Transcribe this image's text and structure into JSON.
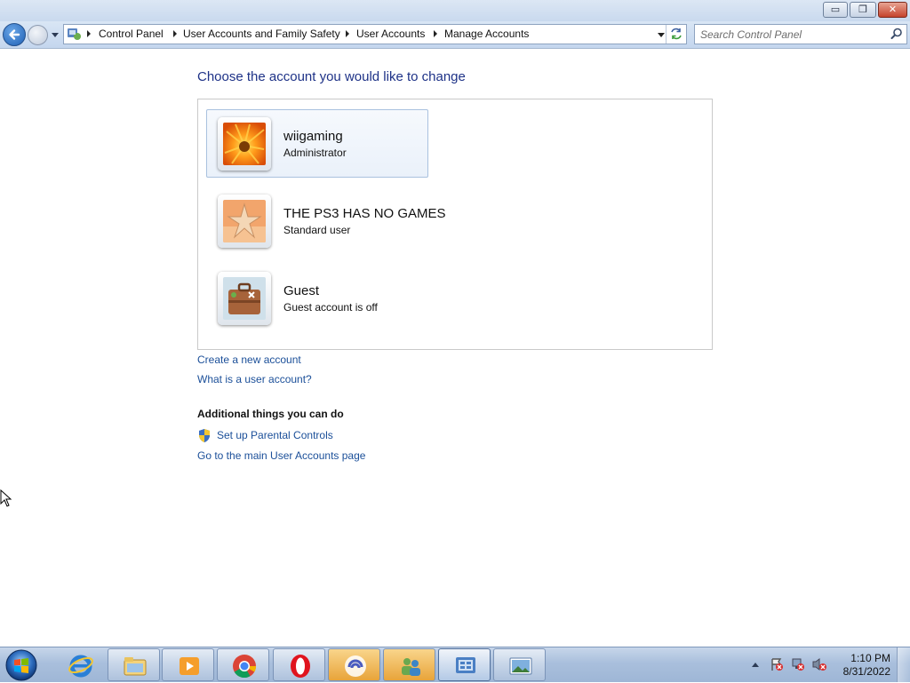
{
  "window": {
    "caption_buttons": {
      "minimize": "▭",
      "restore": "❐",
      "close": "✕"
    }
  },
  "address_bar": {
    "breadcrumbs": [
      "Control Panel",
      "User Accounts and Family Safety",
      "User Accounts",
      "Manage Accounts"
    ],
    "icon": "control-panel-icon"
  },
  "search": {
    "placeholder": "Search Control Panel"
  },
  "main": {
    "heading": "Choose the account you would like to change",
    "accounts": [
      {
        "name": "wiigaming",
        "role": "Administrator",
        "picture": "orange-flower",
        "selected": true
      },
      {
        "name": "THE PS3 HAS NO GAMES",
        "role": "Standard user",
        "picture": "starfish",
        "selected": false
      },
      {
        "name": "Guest",
        "role": "Guest account is off",
        "picture": "suitcase",
        "selected": false
      }
    ],
    "links": {
      "create": "Create a new account",
      "what_is": "What is a user account?"
    },
    "additional": {
      "title": "Additional things you can do",
      "parental": "Set up Parental Controls",
      "main_page": "Go to the main User Accounts page"
    }
  },
  "taskbar": {
    "pinned": [
      {
        "icon": "internet-explorer-icon",
        "running": false
      },
      {
        "icon": "file-explorer-icon",
        "running": true
      },
      {
        "icon": "media-player-icon",
        "running": true
      },
      {
        "icon": "chrome-icon",
        "running": true
      },
      {
        "icon": "opera-icon",
        "running": true
      },
      {
        "icon": "bittorrent-icon",
        "running": true
      },
      {
        "icon": "user-accounts-icon",
        "running": true
      },
      {
        "icon": "control-panel-icon",
        "running": true
      },
      {
        "icon": "photo-viewer-icon",
        "running": true
      }
    ],
    "clock": {
      "time": "1:10 PM",
      "date": "8/31/2022"
    }
  },
  "colors": {
    "link": "#1b4f99",
    "heading": "#1e3287",
    "taskbar": "#a9bfdc"
  }
}
